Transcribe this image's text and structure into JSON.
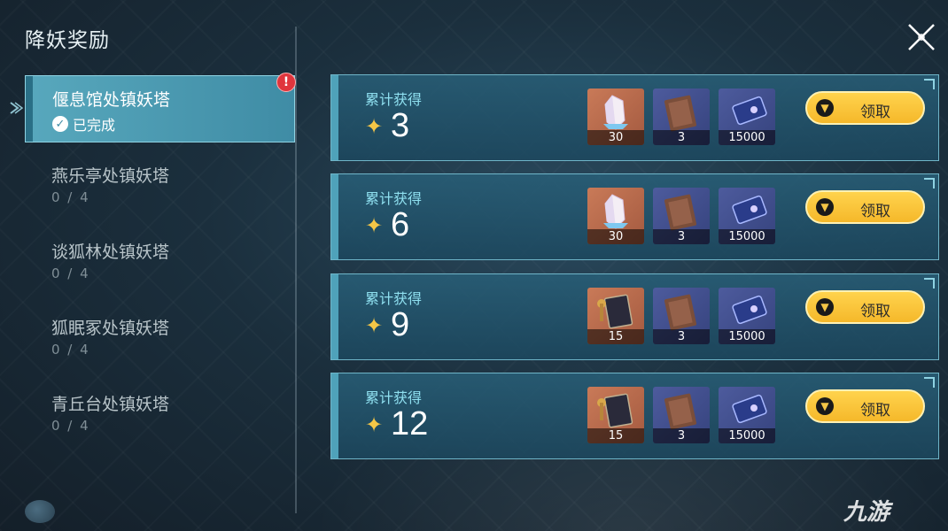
{
  "title": "降妖奖励",
  "sidebar": {
    "items": [
      {
        "name": "偃息馆处镇妖塔",
        "status": "已完成",
        "progress": "",
        "active": true
      },
      {
        "name": "燕乐亭处镇妖塔",
        "status": "",
        "progress": "0 / 4",
        "active": false
      },
      {
        "name": "谈狐林处镇妖塔",
        "status": "",
        "progress": "0 / 4",
        "active": false
      },
      {
        "name": "狐眠冢处镇妖塔",
        "status": "",
        "progress": "0 / 4",
        "active": false
      },
      {
        "name": "青丘台处镇妖塔",
        "status": "",
        "progress": "0 / 4",
        "active": false
      }
    ]
  },
  "rewards": [
    {
      "label": "累计获得",
      "count": "3",
      "items": [
        {
          "icon": "crystal-icon",
          "qty": "30"
        },
        {
          "icon": "book-icon",
          "qty": "3"
        },
        {
          "icon": "ticket-icon",
          "qty": "15000"
        }
      ],
      "claim_label": "领取"
    },
    {
      "label": "累计获得",
      "count": "6",
      "items": [
        {
          "icon": "crystal-icon",
          "qty": "30"
        },
        {
          "icon": "book-icon",
          "qty": "3"
        },
        {
          "icon": "ticket-icon",
          "qty": "15000"
        }
      ],
      "claim_label": "领取"
    },
    {
      "label": "累计获得",
      "count": "9",
      "items": [
        {
          "icon": "tome-icon",
          "qty": "15"
        },
        {
          "icon": "book-icon",
          "qty": "3"
        },
        {
          "icon": "ticket-icon",
          "qty": "15000"
        }
      ],
      "claim_label": "领取"
    },
    {
      "label": "累计获得",
      "count": "12",
      "items": [
        {
          "icon": "tome-icon",
          "qty": "15"
        },
        {
          "icon": "book-icon",
          "qty": "3"
        },
        {
          "icon": "ticket-icon",
          "qty": "15000"
        }
      ],
      "claim_label": "领取"
    }
  ],
  "watermark": "九游",
  "colors": {
    "accent": "#4fa2ba",
    "button": "#f5c646",
    "alert": "#e0353d"
  }
}
